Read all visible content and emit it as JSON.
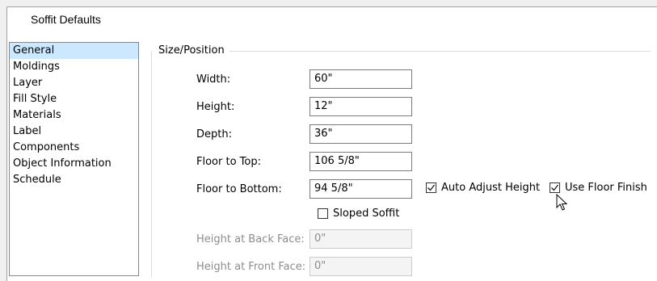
{
  "dialog": {
    "title": "Soffit Defaults"
  },
  "sidebar": {
    "items": [
      {
        "label": "General",
        "selected": true
      },
      {
        "label": "Moldings"
      },
      {
        "label": "Layer"
      },
      {
        "label": "Fill Style"
      },
      {
        "label": "Materials"
      },
      {
        "label": "Label"
      },
      {
        "label": "Components"
      },
      {
        "label": "Object Information"
      },
      {
        "label": "Schedule"
      }
    ]
  },
  "size_position": {
    "group_label": "Size/Position",
    "width": {
      "label": "Width:",
      "value": "60\""
    },
    "height": {
      "label": "Height:",
      "value": "12\""
    },
    "depth": {
      "label": "Depth:",
      "value": "36\""
    },
    "floor_to_top": {
      "label": "Floor to Top:",
      "value": "106 5/8\""
    },
    "floor_to_bottom": {
      "label": "Floor to Bottom:",
      "value": "94 5/8\""
    },
    "auto_adjust_height": {
      "label": "Auto Adjust Height",
      "checked": true
    },
    "use_floor_finish": {
      "label": "Use Floor Finish",
      "checked": true
    },
    "sloped_soffit": {
      "label": "Sloped Soffit",
      "checked": false
    },
    "height_back_face": {
      "label": "Height at Back Face:",
      "value": "0\""
    },
    "height_front_face": {
      "label": "Height at Front Face:",
      "value": "0\""
    }
  },
  "colors": {
    "selection": "#cce8ff",
    "disabled_text": "#8c8c8c"
  }
}
